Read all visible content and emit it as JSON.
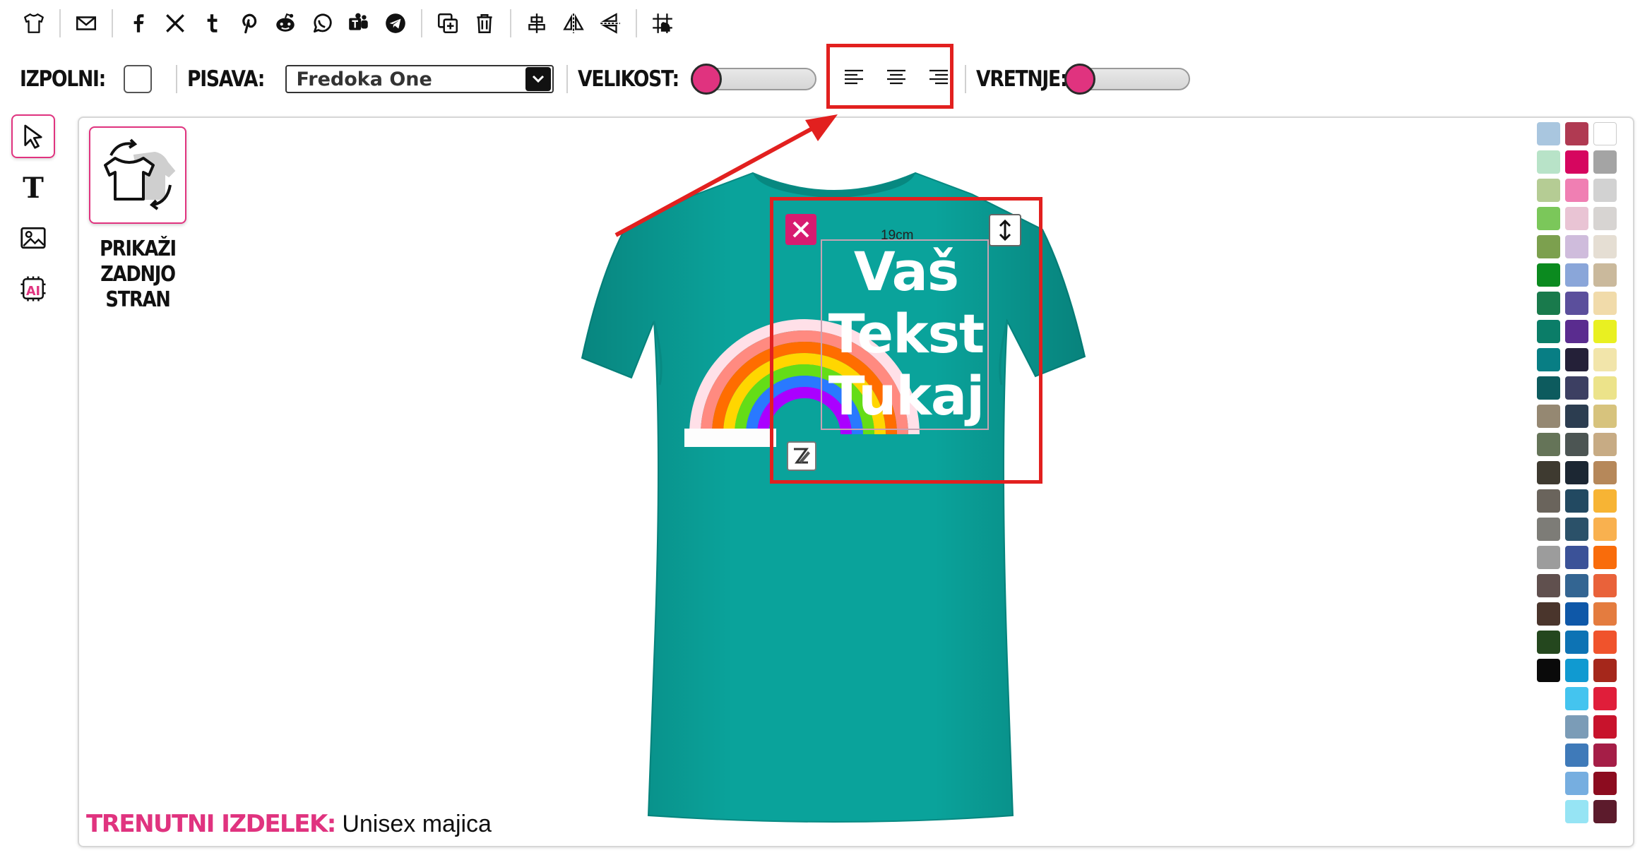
{
  "toolbar": {
    "icons": [
      "tshirt-icon",
      "mail-icon",
      "facebook-icon",
      "x-icon",
      "tumblr-icon",
      "pinterest-icon",
      "reddit-icon",
      "whatsapp-icon",
      "teams-icon",
      "telegram-icon",
      "duplicate-icon",
      "trash-icon",
      "center-align-icon",
      "flip-horizontal-icon",
      "flip-vertical-icon",
      "grid-icon"
    ]
  },
  "options": {
    "fill_label": "IZPOLNI:",
    "font_label": "PISAVA:",
    "font_value": "Fredoka One",
    "size_label": "VELIKOST:",
    "size_level": 0,
    "rotation_label": "VRETNJE:",
    "rotation_level": 0
  },
  "left_tools": [
    "select-tool-icon",
    "text-tool-icon",
    "image-tool-icon",
    "ai-tool-icon"
  ],
  "canvas": {
    "back_label_1": "PRIKAŽI",
    "back_label_2": "ZADNJO",
    "back_label_3": "STRAN",
    "shirt_color": "#009b94",
    "design": {
      "line1": "Vaš",
      "line2": "Tekst",
      "line3": "Tukaj",
      "width_label": "19cm"
    },
    "current_product_label": "TRENUTNI IZDELEK:",
    "current_product_value": "Unisex majica"
  },
  "accent_color": "#e0337f",
  "highlight_color": "#e2201f",
  "swatches": [
    "#a9c6df",
    "#b03a52",
    "#ffffff",
    "#b8e3c8",
    "#d6065f",
    "#a4a4a4",
    "#b5cc94",
    "#f07fb3",
    "#d2d2d2",
    "#7bc75a",
    "#e9c4d4",
    "#d7d4d2",
    "#7ca04e",
    "#cfbcdc",
    "#e5ded3",
    "#0b8a1f",
    "#8aa6d9",
    "#cab99c",
    "#197a4c",
    "#5b4f9c",
    "#f1dbaa",
    "#0b7d68",
    "#5a2c8f",
    "#e9f021",
    "#087e84",
    "#242038",
    "#f2e5aa",
    "#0d5b5e",
    "#3c3f62",
    "#ece38a",
    "#958872",
    "#2c3d50",
    "#d7c37d",
    "#657458",
    "#4c5553",
    "#c7ab84",
    "#3e3a30",
    "#1c2733",
    "#b6885a",
    "#6a645c",
    "#224961",
    "#f7b434",
    "#7d7c77",
    "#2b5169",
    "#f9b14f",
    "#9c9c9c",
    "#3b5298",
    "#f96c0b",
    "#60504e",
    "#336592",
    "#e9623a",
    "#4a352c",
    "#0f58a8",
    "#e47c3f",
    "#24471e",
    "#0d73b4",
    "#f0532c",
    "#0a0a0a",
    "#109ad1",
    "#a5271b",
    "",
    "#44c4ef",
    "#e01e3a",
    "",
    "#7b9cb7",
    "#c8132c",
    "",
    "#3f7ab9",
    "#a51e47",
    "",
    "#76aee0",
    "#8c0c1f",
    "",
    "#96e4f4",
    "#5c1b2c"
  ]
}
